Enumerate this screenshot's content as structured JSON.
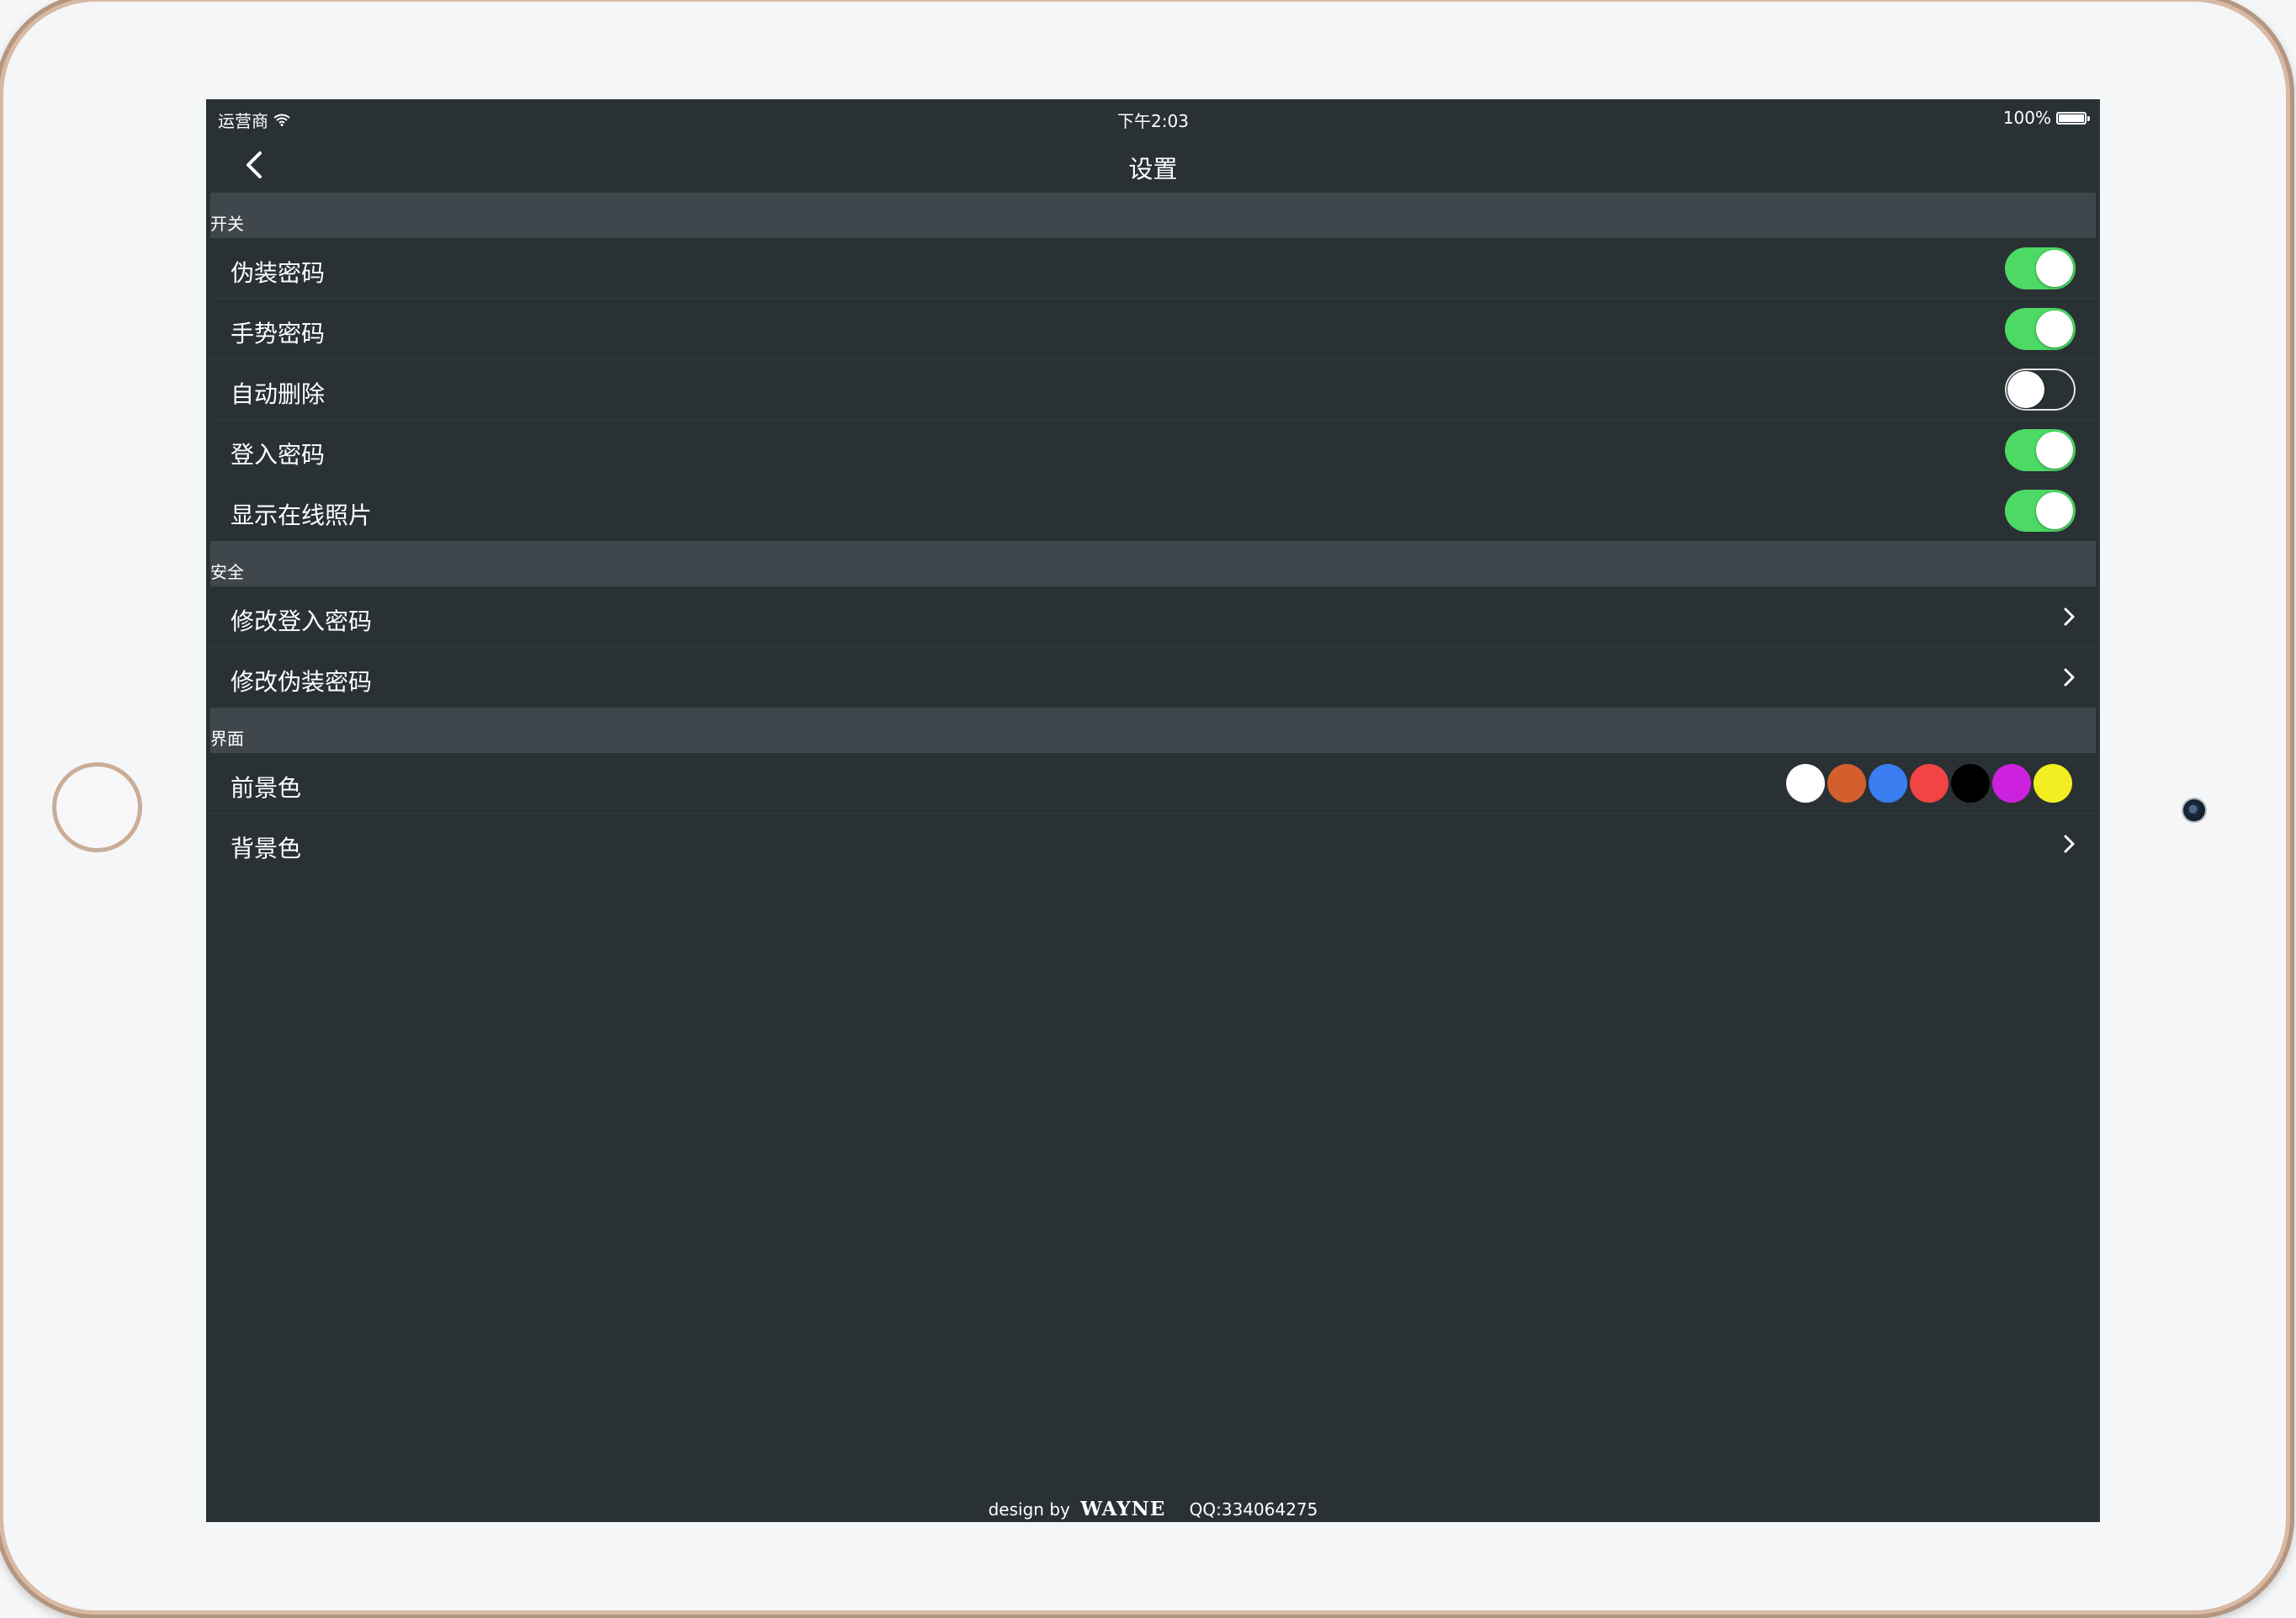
{
  "status_bar": {
    "carrier": "运营商",
    "time": "下午2:03",
    "battery": "100%"
  },
  "nav": {
    "title": "设置"
  },
  "sections": {
    "switches": {
      "header": "开关",
      "rows": [
        {
          "label": "伪装密码",
          "on": true
        },
        {
          "label": "手势密码",
          "on": true
        },
        {
          "label": "自动删除",
          "on": false
        },
        {
          "label": "登入密码",
          "on": true
        },
        {
          "label": "显示在线照片",
          "on": true
        }
      ]
    },
    "security": {
      "header": "安全",
      "rows": [
        {
          "label": "修改登入密码"
        },
        {
          "label": "修改伪装密码"
        }
      ]
    },
    "interface": {
      "header": "界面",
      "rows": [
        {
          "label": "前景色"
        },
        {
          "label": "背景色"
        }
      ],
      "foreground_colors": [
        "#ffffff",
        "#d35f2e",
        "#3a7ef2",
        "#f24444",
        "#000000",
        "#cc22dd",
        "#f2ee22"
      ]
    }
  },
  "footer": {
    "prefix": "design by",
    "brand": "WAYNE",
    "qq": "QQ:334064275"
  },
  "colors": {
    "toggle_on": "#4cd964",
    "background": "#293134",
    "section_header": "#40474c"
  }
}
